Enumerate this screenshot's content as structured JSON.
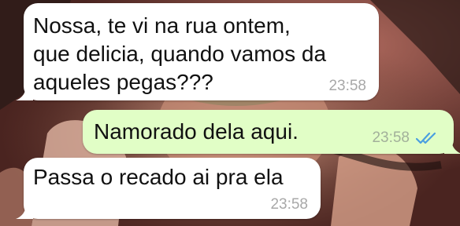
{
  "messages": [
    {
      "direction": "incoming",
      "lines": [
        "Nossa, te vi na rua ontem,",
        "que delicia, quando vamos da",
        "aqueles pegas???"
      ],
      "time": "23:58"
    },
    {
      "direction": "outgoing",
      "lines": [
        "Namorado dela aqui."
      ],
      "time": "23:58",
      "status": "read",
      "status_icon": "double-check-icon"
    },
    {
      "direction": "incoming",
      "lines": [
        "Passa o recado ai pra ela"
      ],
      "time": "23:58"
    }
  ],
  "colors": {
    "incoming_bubble": "#ffffff",
    "outgoing_bubble": "#e1fec6",
    "read_ticks": "#4a9fe0",
    "timestamp": "#a8a8a8"
  }
}
